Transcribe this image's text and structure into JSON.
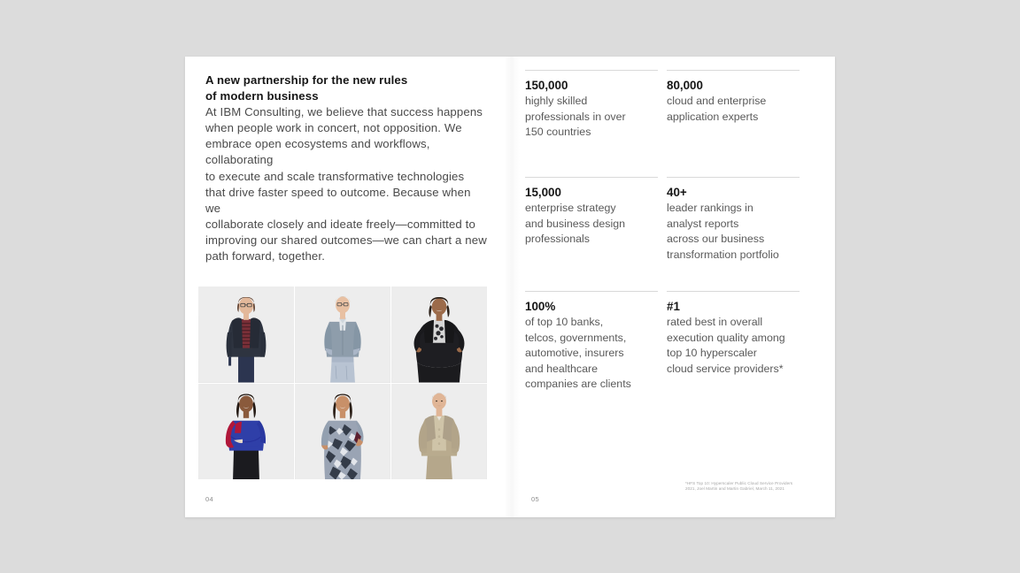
{
  "document": {
    "type": "print-spread",
    "background_color": "#dcdcdc",
    "page_color": "#ffffff"
  },
  "left_page": {
    "page_number": "04",
    "heading": [
      "A new partnership for the new rules",
      "of modern business"
    ],
    "body": [
      "At IBM Consulting, we believe that success happens",
      "when people work in concert, not opposition. We",
      "embrace open ecosystems and workflows, collaborating",
      "to execute and scale transformative technologies",
      "that drive faster speed to outcome. Because when we",
      "collaborate closely and ideate freely—committed to",
      "improving our shared outcomes—we can chart a new",
      "path forward, together."
    ],
    "photo_grid": {
      "columns": 3,
      "rows": 2,
      "photos": [
        {
          "name": "portrait-woman-dark-blazer",
          "skin": "#e3b89a",
          "hair": "#5a3a28",
          "top": "#2e3440",
          "accent": "#7a2f38",
          "bottom": "#2c3550",
          "pose": "arms-down"
        },
        {
          "name": "portrait-man-blue-shirt",
          "skin": "#e8c0a2",
          "hair": "#b9a68f",
          "top": "#8e9dab",
          "accent": "#7b8b99",
          "bottom": "#b8c3d2",
          "pose": "hands-in-pockets"
        },
        {
          "name": "portrait-woman-black-cardigan",
          "skin": "#9c6b4a",
          "hair": "#2b2018",
          "top": "#1e1e22",
          "accent": "#d7d7d7",
          "bottom": "#1e1e22",
          "pose": "hands-on-hips"
        },
        {
          "name": "portrait-woman-blue-sweater",
          "skin": "#8a5a3c",
          "hair": "#241a14",
          "top": "#2f3fa8",
          "accent": "#b0173a",
          "bottom": "#1b1b1f",
          "pose": "arms-crossed"
        },
        {
          "name": "portrait-woman-patterned-top",
          "skin": "#c89069",
          "hair": "#2a1e16",
          "top": "#9aa4b4",
          "accent": "#5c2030",
          "bottom": "#8e97a6",
          "pose": "hand-on-hip"
        },
        {
          "name": "portrait-man-tan-suit",
          "skin": "#e0b596",
          "hair": "#6b563f",
          "top": "#b9ab8e",
          "accent": "#cfc4a8",
          "bottom": "#b5a78b",
          "pose": "hands-in-pockets"
        }
      ]
    }
  },
  "right_page": {
    "page_number": "05",
    "stats": [
      {
        "id": "stat-professionals",
        "value": "150,000",
        "description": [
          "highly skilled",
          "professionals in over",
          "150 countries"
        ]
      },
      {
        "id": "stat-cloud-experts",
        "value": "80,000",
        "description": [
          "cloud and enterprise",
          "application experts"
        ]
      },
      {
        "id": "stat-strategy-professionals",
        "value": "15,000",
        "description": [
          "enterprise strategy",
          "and business design",
          "professionals"
        ]
      },
      {
        "id": "stat-leader-rankings",
        "value": "40+",
        "description": [
          "leader rankings in",
          "analyst reports",
          "across our business",
          "transformation portfolio"
        ]
      },
      {
        "id": "stat-top-clients",
        "value": "100%",
        "description": [
          "of top 10 banks,",
          "telcos, governments,",
          "automotive, insurers",
          "and healthcare",
          "companies are clients"
        ]
      },
      {
        "id": "stat-rated-best",
        "value": "#1",
        "description": [
          "rated best in overall",
          "execution quality among",
          "top 10 hyperscaler",
          "cloud service providers*"
        ]
      }
    ],
    "footnote": [
      "*HFS Top 10: Hyperscaler Public Cloud Service Providers",
      "2021, Joel Martin and Martin Gabriel, March 11, 2021"
    ]
  }
}
